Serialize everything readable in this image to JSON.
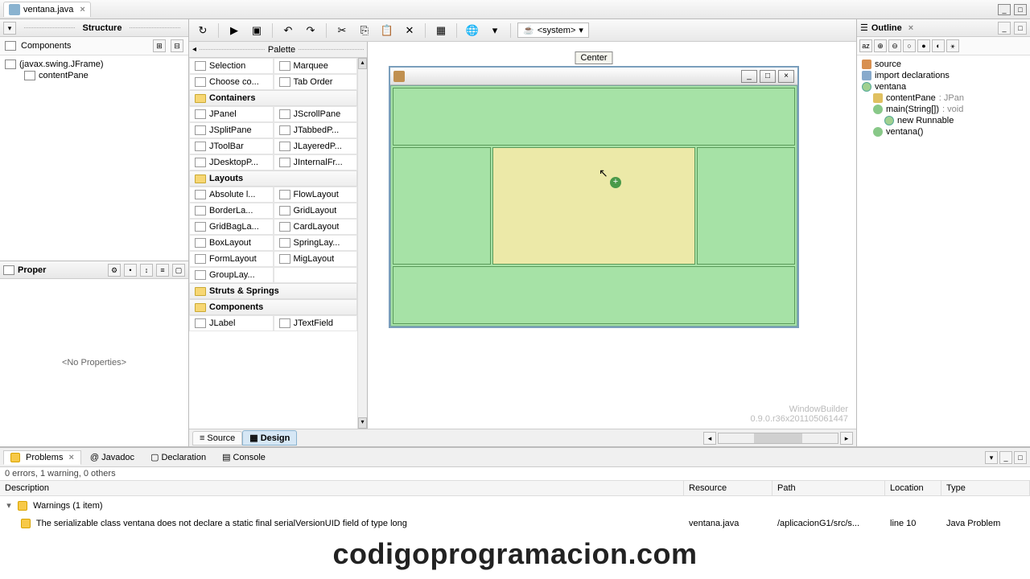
{
  "file_tab": {
    "name": "ventana.java"
  },
  "structure": {
    "title": "Structure",
    "components_label": "Components",
    "tree": [
      {
        "label": "(javax.swing.JFrame)",
        "indent": 0
      },
      {
        "label": "contentPane",
        "indent": 1
      }
    ]
  },
  "properties": {
    "title": "Proper",
    "empty_text": "<No Properties>"
  },
  "palette": {
    "title": "Palette",
    "tools": [
      [
        "Selection",
        "Marquee"
      ],
      [
        "Choose co...",
        "Tab Order"
      ]
    ],
    "categories": [
      {
        "name": "Containers",
        "items": [
          [
            "JPanel",
            "JScrollPane"
          ],
          [
            "JSplitPane",
            "JTabbedP..."
          ],
          [
            "JToolBar",
            "JLayeredP..."
          ],
          [
            "JDesktopP...",
            "JInternalFr..."
          ]
        ]
      },
      {
        "name": "Layouts",
        "items": [
          [
            "Absolute l...",
            "FlowLayout"
          ],
          [
            "BorderLa...",
            "GridLayout"
          ],
          [
            "GridBagLa...",
            "CardLayout"
          ],
          [
            "BoxLayout",
            "SpringLay..."
          ],
          [
            "FormLayout",
            "MigLayout"
          ],
          [
            "GroupLay...",
            ""
          ]
        ]
      },
      {
        "name": "Struts & Springs",
        "items": []
      },
      {
        "name": "Components",
        "items": [
          [
            "JLabel",
            "JTextField"
          ]
        ]
      }
    ]
  },
  "canvas": {
    "drop_label": "Center",
    "credit_name": "WindowBuilder",
    "credit_ver": "0.9.0.r36x201105061447"
  },
  "toolbar": {
    "system_label": "<system>"
  },
  "source_design": {
    "source": "Source",
    "design": "Design"
  },
  "outline": {
    "title": "Outline",
    "nodes": [
      {
        "label": "source",
        "cls": "pkg",
        "indent": 0
      },
      {
        "label": "import declarations",
        "cls": "imp",
        "indent": 0
      },
      {
        "label": "ventana",
        "cls": "cls",
        "indent": 0
      },
      {
        "label": "contentPane",
        "suffix": " : JPan",
        "cls": "fld",
        "indent": 1
      },
      {
        "label": "main(String[])",
        "suffix": " : void",
        "cls": "mtd",
        "indent": 1
      },
      {
        "label": "new Runnable",
        "suffix": "",
        "cls": "cls",
        "indent": 2
      },
      {
        "label": "ventana()",
        "suffix": "",
        "cls": "mtd",
        "indent": 1
      }
    ]
  },
  "problems": {
    "tabs": {
      "problems": "Problems",
      "javadoc": "Javadoc",
      "declaration": "Declaration",
      "console": "Console"
    },
    "summary": "0 errors, 1 warning, 0 others",
    "columns": {
      "desc": "Description",
      "res": "Resource",
      "path": "Path",
      "loc": "Location",
      "type": "Type"
    },
    "group": "Warnings (1 item)",
    "rows": [
      {
        "desc": "The serializable class ventana does not declare a static final serialVersionUID field of type long",
        "res": "ventana.java",
        "path": "/aplicacionG1/src/s...",
        "loc": "line 10",
        "type": "Java Problem"
      }
    ]
  },
  "watermark": "codigoprogramacion.com"
}
